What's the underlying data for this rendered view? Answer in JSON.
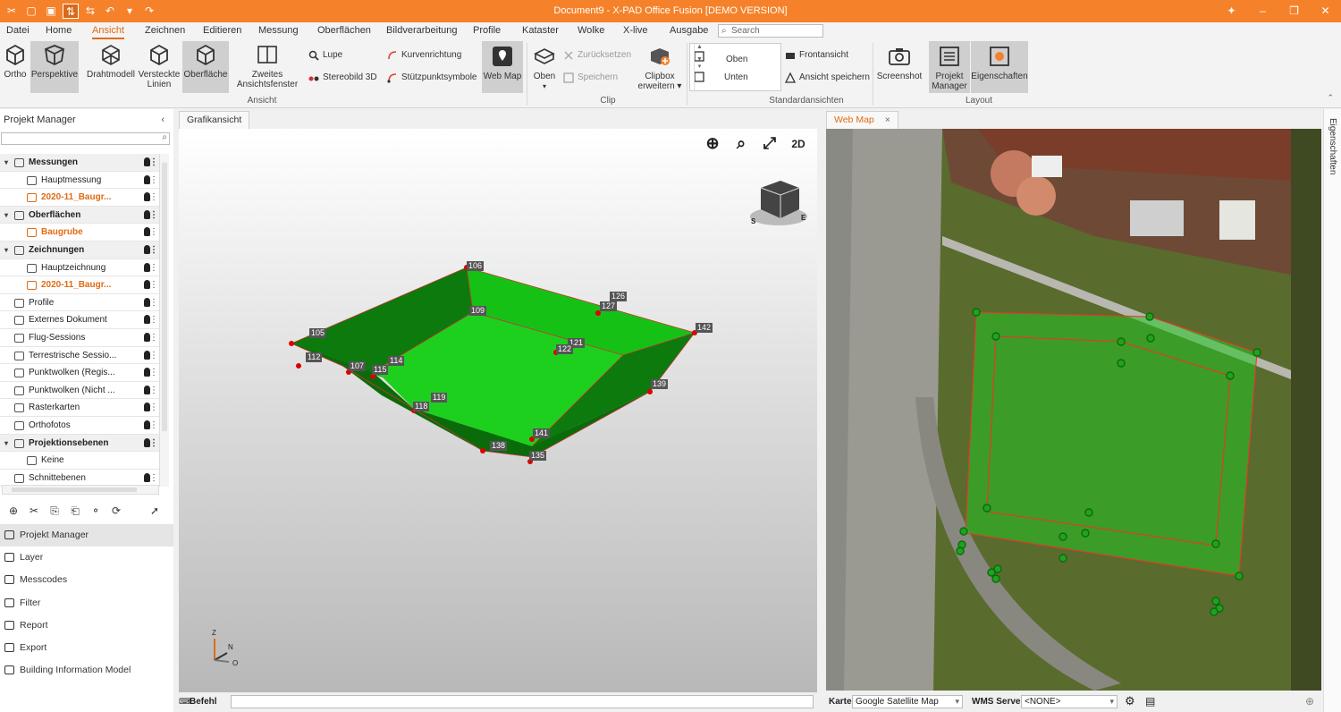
{
  "titlebar": {
    "title": "Document9 - X-PAD Office Fusion [DEMO VERSION]",
    "quick_access": [
      "cut-icon",
      "new-icon",
      "save-icon",
      "measure-icon",
      "swap-icon",
      "undo-icon",
      "dropdown-icon",
      "redo-icon"
    ],
    "window_controls": [
      "✦",
      "–",
      "❐",
      "✕"
    ]
  },
  "menu": [
    "Datei",
    "Home",
    "Ansicht",
    "Zeichnen",
    "Editieren",
    "Messung",
    "Oberflächen",
    "Bildverarbeitung",
    "Profile",
    "Kataster",
    "Wolke",
    "X-live",
    "Ausgabe"
  ],
  "menu_active": "Ansicht",
  "search_placeholder": "Search",
  "ribbon": {
    "ortho": "Ortho",
    "perspektive": "Perspektive",
    "drahtmodell": "Drahtmodell",
    "versteckte": "Versteckte Linien",
    "oberflaeche": "Oberfläche",
    "zweites": "Zweites Ansichtsfenster",
    "lupe": "Lupe",
    "stereobild": "Stereobild 3D",
    "kurvenrichtung": "Kurvenrichtung",
    "stuetzpunkt": "Stützpunktsymbole",
    "webmap": "Web Map",
    "oben_btn": "Oben",
    "zuruecksetzen": "Zurücksetzen",
    "speichern": "Speichern",
    "clipbox": "Clipbox erweitern",
    "std_oben": "Oben",
    "std_unten": "Unten",
    "frontansicht": "Frontansicht",
    "ansicht_speichern": "Ansicht speichern",
    "screenshot": "Screenshot",
    "projekt_manager": "Projekt Manager",
    "eigenschaften": "Eigenschaften",
    "groups": {
      "ansicht": "Ansicht",
      "clip": "Clip",
      "standard": "Standardansichten",
      "layout": "Layout"
    }
  },
  "left_panel": {
    "title": "Projekt Manager",
    "tree": [
      {
        "label": "Messungen",
        "level": 0,
        "group": true,
        "expand": "▾",
        "orange": false
      },
      {
        "label": "Hauptmessung",
        "level": 1,
        "group": false,
        "expand": "",
        "orange": false
      },
      {
        "label": "2020-11_Baugr...",
        "level": 1,
        "group": false,
        "expand": "",
        "orange": true
      },
      {
        "label": "Oberflächen",
        "level": 0,
        "group": true,
        "expand": "▾",
        "orange": false
      },
      {
        "label": "Baugrube",
        "level": 1,
        "group": false,
        "expand": "",
        "orange": true
      },
      {
        "label": "Zeichnungen",
        "level": 0,
        "group": true,
        "expand": "▾",
        "orange": false
      },
      {
        "label": "Hauptzeichnung",
        "level": 1,
        "group": false,
        "expand": "",
        "orange": false
      },
      {
        "label": "2020-11_Baugr...",
        "level": 1,
        "group": false,
        "expand": "",
        "orange": true
      },
      {
        "label": "Profile",
        "level": 0,
        "group": false,
        "expand": "",
        "orange": false
      },
      {
        "label": "Externes Dokument",
        "level": 0,
        "group": false,
        "expand": "",
        "orange": false
      },
      {
        "label": "Flug-Sessions",
        "level": 0,
        "group": false,
        "expand": "",
        "orange": false
      },
      {
        "label": "Terrestrische Sessio...",
        "level": 0,
        "group": false,
        "expand": "",
        "orange": false
      },
      {
        "label": "Punktwolken (Regis...",
        "level": 0,
        "group": false,
        "expand": "",
        "orange": false
      },
      {
        "label": "Punktwolken (Nicht ...",
        "level": 0,
        "group": false,
        "expand": "",
        "orange": false
      },
      {
        "label": "Rasterkarten",
        "level": 0,
        "group": false,
        "expand": "",
        "orange": false
      },
      {
        "label": "Orthofotos",
        "level": 0,
        "group": false,
        "expand": "",
        "orange": false
      },
      {
        "label": "Projektionsebenen",
        "level": 0,
        "group": true,
        "expand": "▾",
        "orange": false
      },
      {
        "label": "Keine",
        "level": 1,
        "group": false,
        "expand": "",
        "orange": false
      },
      {
        "label": "Schnittebenen",
        "level": 0,
        "group": false,
        "expand": "",
        "orange": false
      }
    ],
    "nav": [
      "Projekt Manager",
      "Layer",
      "Messcodes",
      "Filter",
      "Report",
      "Export",
      "Building Information Model"
    ]
  },
  "tabs": {
    "graphic": "Grafikansicht",
    "webmap": "Web Map"
  },
  "viewport_labels": [
    "106",
    "126",
    "127",
    "109",
    "142",
    "105",
    "121",
    "122",
    "112",
    "107",
    "115",
    "114",
    "139",
    "119",
    "118",
    "141",
    "138",
    "135"
  ],
  "cmd_label": "Befehl",
  "webmap_bar": {
    "karte_label": "Karte",
    "karte_value": "Google Satellite Map",
    "wms_label": "WMS Server",
    "wms_value": "<NONE>"
  },
  "side_label": "Eigenschaften",
  "colors": {
    "accent": "#f5822a",
    "active_text": "#e06b13",
    "surface": "#16c116"
  }
}
